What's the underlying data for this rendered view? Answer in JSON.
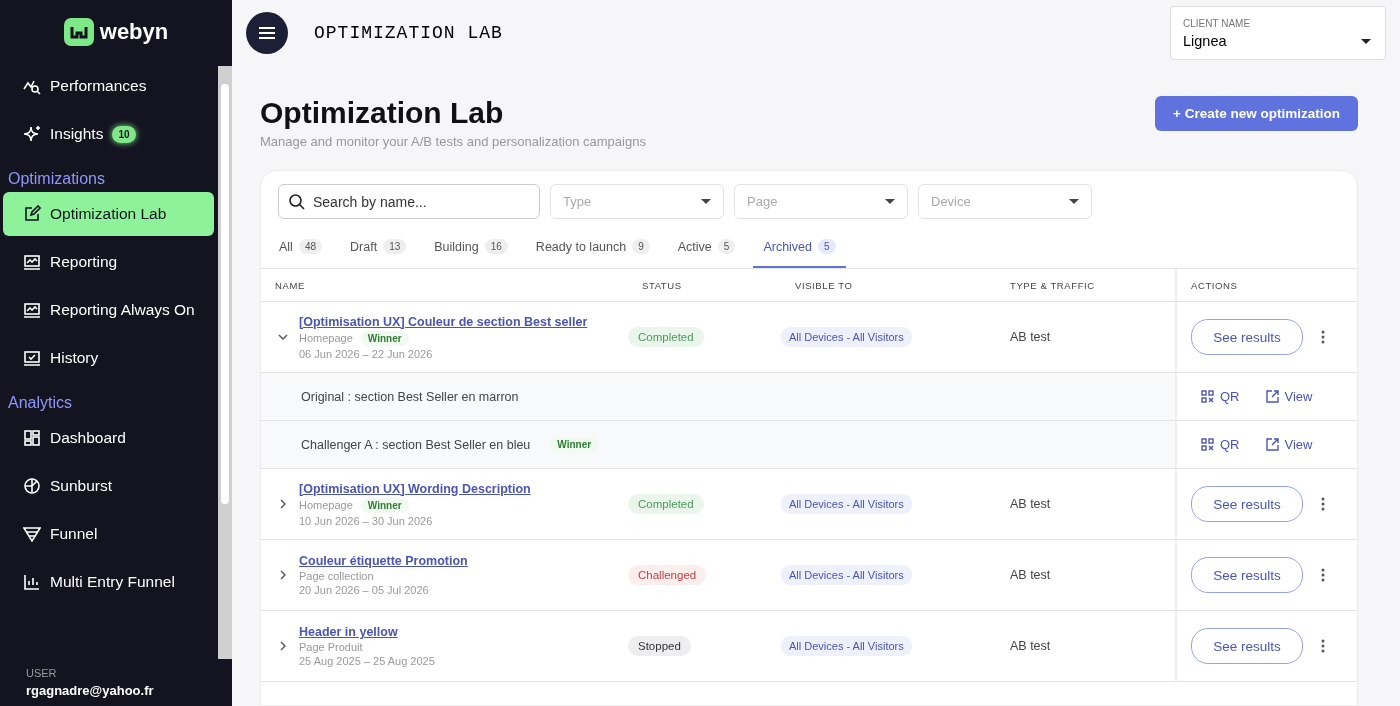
{
  "sidebar": {
    "logo": "webyn",
    "sections": [
      {
        "items": [
          {
            "label": "Performances",
            "kind": "performance",
            "selected": false
          },
          {
            "label": "Insights",
            "kind": "sparkle",
            "badge": "10",
            "selected": false
          }
        ]
      },
      {
        "title": "Optimizations",
        "items": [
          {
            "label": "Optimization Lab",
            "kind": "edit",
            "selected": true
          },
          {
            "label": "Reporting",
            "kind": "report",
            "selected": false
          },
          {
            "label": "Reporting Always On",
            "kind": "report",
            "selected": false
          },
          {
            "label": "History",
            "kind": "history",
            "selected": false
          }
        ]
      },
      {
        "title": "Analytics",
        "items": [
          {
            "label": "Dashboard",
            "kind": "dashboard",
            "selected": false
          },
          {
            "label": "Sunburst",
            "kind": "sunburst",
            "selected": false
          },
          {
            "label": "Funnel",
            "kind": "funnel",
            "selected": false
          },
          {
            "label": "Multi Entry Funnel",
            "kind": "chart",
            "selected": false
          }
        ]
      }
    ],
    "user": {
      "label": "USER",
      "email": "rgagnadre@yahoo.fr"
    }
  },
  "topbar": {
    "title": "OPTIMIZATION LAB",
    "client": {
      "label": "CLIENT NAME",
      "value": "Lignea"
    }
  },
  "page": {
    "title": "Optimization Lab",
    "subtitle": "Manage and monitor your A/B tests and personalization campaigns",
    "create_button": "+ Create new optimization"
  },
  "filters": {
    "search": {
      "placeholder": "Search by name..."
    },
    "selects": [
      {
        "placeholder": "Type"
      },
      {
        "placeholder": "Page"
      },
      {
        "placeholder": "Device"
      }
    ]
  },
  "tabs": [
    {
      "label": "All",
      "count": "48",
      "selected": false
    },
    {
      "label": "Draft",
      "count": "13",
      "selected": false
    },
    {
      "label": "Building",
      "count": "16",
      "selected": false
    },
    {
      "label": "Ready to launch",
      "count": "9",
      "selected": false
    },
    {
      "label": "Active",
      "count": "5",
      "selected": false
    },
    {
      "label": "Archived",
      "count": "5",
      "selected": true
    }
  ],
  "table": {
    "columns": [
      "NAME",
      "STATUS",
      "VISIBLE TO",
      "TYPE & TRAFFIC",
      "ACTIONS"
    ],
    "rows": [
      {
        "title": "[Optimisation UX] Couleur de section Best seller",
        "page": "Homepage",
        "winner": "Winner",
        "dates": "06 Jun 2026 – 22 Jun 2026",
        "status": {
          "label": "Completed",
          "kind": "completed"
        },
        "visible_to": "All Devices - All Visitors",
        "type": "AB test",
        "action": "See results",
        "expanded": true,
        "variants": [
          {
            "label": "Original : section Best Seller en marron",
            "qr": "QR",
            "view": "View"
          },
          {
            "label": "Challenger A : section Best Seller en bleu",
            "winner": "Winner",
            "qr": "QR",
            "view": "View"
          }
        ]
      },
      {
        "title": "[Optimisation UX] Wording Description",
        "page": "Homepage",
        "winner": "Winner",
        "dates": "10 Jun 2026 – 30 Jun 2026",
        "status": {
          "label": "Completed",
          "kind": "completed"
        },
        "visible_to": "All Devices - All Visitors",
        "type": "AB test",
        "action": "See results",
        "expanded": false
      },
      {
        "title": "Couleur étiquette Promotion",
        "page": "Page collection",
        "dates": "20 Jun 2026 – 05 Jul 2026",
        "status": {
          "label": "Challenged",
          "kind": "challenged"
        },
        "visible_to": "All Devices - All Visitors",
        "type": "AB test",
        "action": "See results",
        "expanded": false
      },
      {
        "title": "Header in yellow",
        "page": "Page Produit",
        "dates": "25 Aug 2025 – 25 Aug 2025",
        "status": {
          "label": "Stopped",
          "kind": "stopped"
        },
        "visible_to": "All Devices - All Visitors",
        "type": "AB test",
        "action": "See results",
        "expanded": false
      }
    ]
  }
}
